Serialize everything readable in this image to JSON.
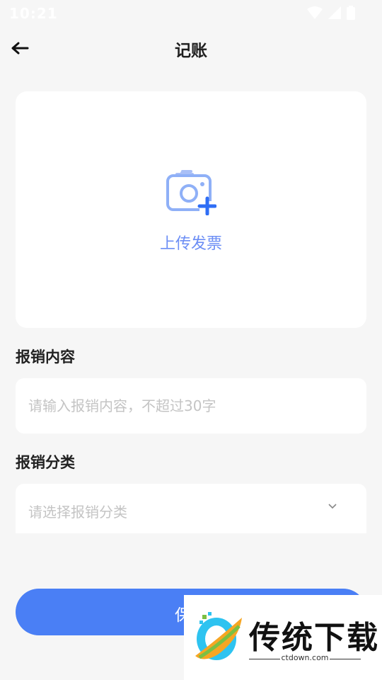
{
  "status_bar": {
    "time": "10:21"
  },
  "app_bar": {
    "title": "记账"
  },
  "upload": {
    "label": "上传发票"
  },
  "content_section": {
    "label": "报销内容",
    "placeholder": "请输入报销内容，不超过30字",
    "value": ""
  },
  "category_section": {
    "label": "报销分类",
    "placeholder": "请选择报销分类"
  },
  "save_button": {
    "label": "保"
  },
  "watermark": {
    "title": "传统下载",
    "subtitle": "ctdown.com"
  },
  "colors": {
    "accent": "#4a7ff5",
    "upload_text": "#6c8ef5",
    "background": "#f6f6f6"
  }
}
